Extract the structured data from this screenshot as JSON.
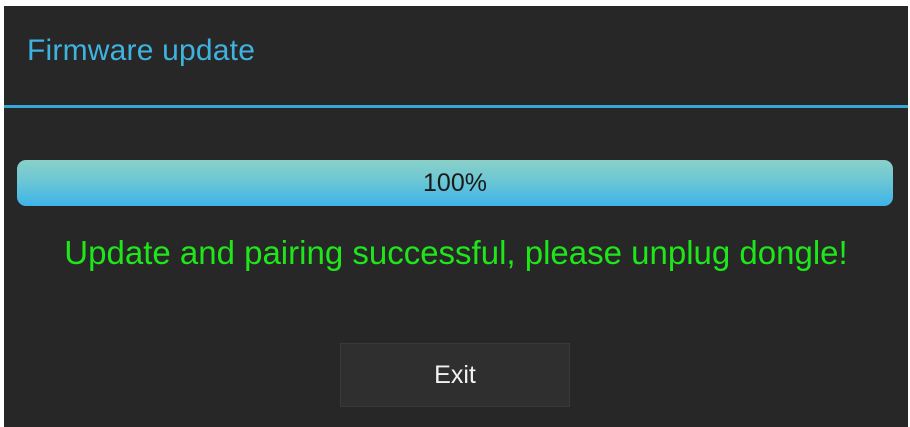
{
  "dialog": {
    "title": "Firmware update",
    "accent_color": "#3fb3e0",
    "background_color": "#272727"
  },
  "progress": {
    "value": 1.0,
    "label": "100%"
  },
  "status": {
    "message": "Update and pairing successful, please unplug dongle!",
    "color": "#1ee61a"
  },
  "actions": {
    "exit_label": "Exit"
  }
}
